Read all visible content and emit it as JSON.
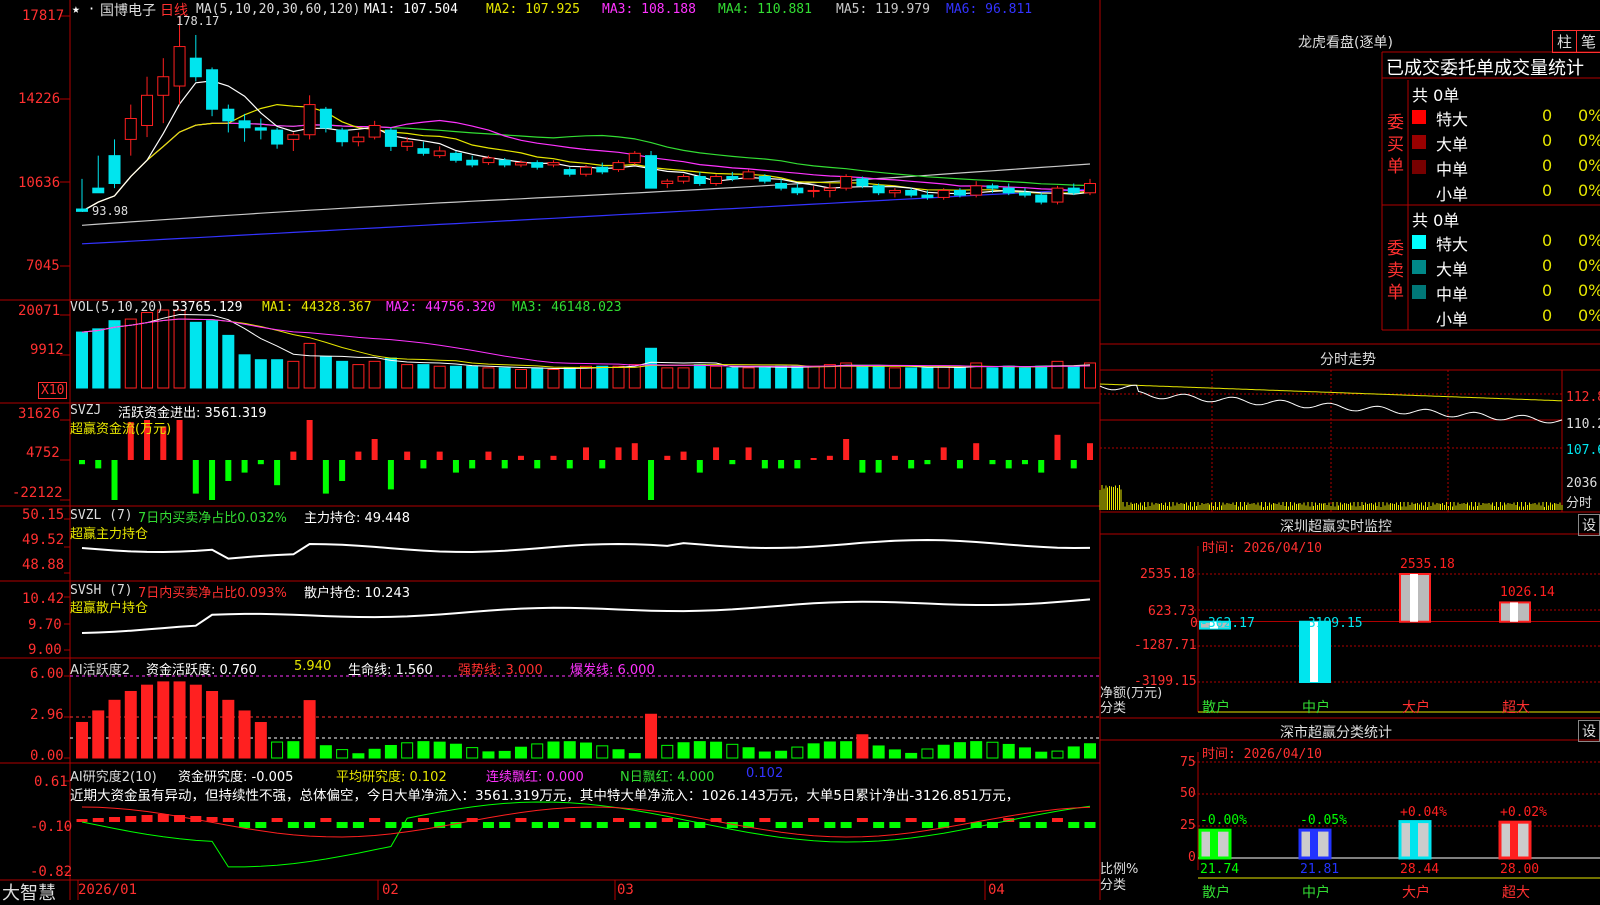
{
  "colors": {
    "bg": "#000000",
    "grid": "#b00000",
    "up": "#ff2020",
    "down": "#00e5ee",
    "ma1": "#ffffff",
    "ma2": "#e6e600",
    "ma3": "#ff33ff",
    "ma4": "#33dd33",
    "ma5": "#c8c8c8",
    "ma6": "#3333ff",
    "neg_green": "#00ff00"
  },
  "header": {
    "stock_name": "国博电子",
    "period": "日线",
    "ma_params": "MA(5,10,20,30,60,120)",
    "ma1": "MA1: 107.504",
    "ma2": "MA2: 107.925",
    "ma3": "MA3: 108.188",
    "ma4": "MA4: 110.881",
    "ma5": "MA5: 119.979",
    "ma6": "MA6: 96.811",
    "high_marker": "178.17",
    "low_marker": "93.98"
  },
  "price_axis": [
    "17817",
    "14226",
    "10636",
    "7045"
  ],
  "vol_panel": {
    "title": "VOL(5,10,20)",
    "value": "53765.129",
    "ma1": "MA1: 44328.367",
    "ma2": "MA2: 44756.320",
    "ma3": "MA3: 46148.023",
    "axis": [
      "20071",
      "9912"
    ],
    "unit": "X10"
  },
  "svzj_panel": {
    "title": "SVZJ",
    "label": "活跃资金进出: 3561.319",
    "sub": "超赢资金流(万元)",
    "axis": [
      "31626",
      "4752",
      "-22122"
    ]
  },
  "svzl_panel": {
    "title": "SVZL (7)",
    "label": "7日内买卖净占比0.032%",
    "label2": "主力持仓: 49.448",
    "sub": "超赢主力持仓",
    "axis": [
      "50.15",
      "49.52",
      "48.88"
    ]
  },
  "svsh_panel": {
    "title": "SVSH (7)",
    "label": "7日内买卖净占比0.093%",
    "label2": "散户持仓: 10.243",
    "sub": "超赢散户持仓",
    "axis": [
      "10.42",
      "9.70",
      "9.00"
    ]
  },
  "ai_active_panel": {
    "title": "AI活跃度2",
    "label": "资金活跃度: 0.760",
    "v2": "5.940",
    "label3": "生命线: 1.560",
    "label4": "强势线: 3.000",
    "label5": "爆发线: 6.000",
    "axis": [
      "6.00",
      "2.96",
      "0.00"
    ]
  },
  "ai_research_panel": {
    "title": "AI研究度2(10)",
    "label": "资金研究度: -0.005",
    "label2": "平均研究度: 0.102",
    "label3": "连续飘红: 0.000",
    "label4": "N日飘红: 4.000",
    "label5": "0.102",
    "comment": "近期大资金虽有异动，但持续性不强，总体偏空，今日大单净流入：3561.319万元，其中特大单净流入：1026.143万元，大单5日累计净出-3126.851万元，",
    "axis": [
      "0.61",
      "-0.10",
      "-0.82"
    ]
  },
  "date_axis": [
    "2026/01",
    "02",
    "03",
    "04"
  ],
  "brand": "大智慧",
  "right": {
    "dragon_title": "龙虎看盘(逐单)",
    "tab_bar": "柱",
    "tab_line": "笔",
    "stats_title": "已成交委托单成交量统计",
    "buy_total": "共 0单",
    "buy_side": "委买单",
    "sell_total": "共 0单",
    "sell_side": "委卖单",
    "rows": [
      {
        "name": "特大",
        "count": "0",
        "pct": "0%"
      },
      {
        "name": "大单",
        "count": "0",
        "pct": "0%"
      },
      {
        "name": "中单",
        "count": "0",
        "pct": "0%"
      },
      {
        "name": "小单",
        "count": "0",
        "pct": "0%"
      }
    ],
    "buy_colors": [
      "#ff0000",
      "#990000",
      "#770000",
      "#000000"
    ],
    "sell_colors": [
      "#00ffff",
      "#008888",
      "#007777",
      "#000000"
    ],
    "intraday_title": "分时走势",
    "intraday_axis": [
      "112.8",
      "110.2",
      "107.6"
    ],
    "intraday_vol": "2036",
    "intraday_vol_unit": "分时",
    "monitor_title": "深圳超赢实时监控",
    "setting": "设",
    "monitor_time": "时间: 2026/04/10",
    "monitor_axis": [
      "2535.18",
      "623.73",
      "0",
      "-1287.71",
      "-3199.15"
    ],
    "monitor_unit": "净额(万元)",
    "monitor_cat": "分类",
    "classify_title": "深市超赢分类统计",
    "classify_time": "时间: 2026/04/10",
    "classify_axis": [
      "75",
      "50",
      "25",
      "0"
    ],
    "classify_unit": "比例%",
    "classify_cat": "分类",
    "categories": [
      "散户",
      "中户",
      "大户",
      "超大"
    ]
  },
  "chart_data": [
    {
      "type": "bar",
      "title": "深圳超赢实时监控",
      "ylabel": "净额(万元)",
      "categories": [
        "散户",
        "中户",
        "大户",
        "超大"
      ],
      "values": [
        -362.17,
        -3199.15,
        2535.18,
        1026.14
      ],
      "value_labels": [
        "-362.17",
        "-3199.15",
        "2535.18",
        "1026.14"
      ],
      "ylim": [
        -3199.15,
        2535.18
      ]
    },
    {
      "type": "bar",
      "title": "深市超赢分类统计",
      "ylabel": "比例%",
      "categories": [
        "散户",
        "中户",
        "大户",
        "超大"
      ],
      "values": [
        21.74,
        21.81,
        28.44,
        28.0
      ],
      "value_labels": [
        "21.74",
        "21.81",
        "28.44",
        "28.00"
      ],
      "change_labels": [
        "-0.00%",
        "-0.05%",
        "+0.04%",
        "+0.02%"
      ],
      "ylim": [
        0,
        75
      ]
    },
    {
      "type": "line",
      "title": "candlestick",
      "ylim": [
        70.45,
        178.17
      ],
      "candles": [
        [
          95,
          108,
          93.98,
          94
        ],
        [
          104,
          118,
          102,
          102
        ],
        [
          118,
          125,
          104,
          106
        ],
        [
          125,
          140,
          118,
          134
        ],
        [
          131,
          152,
          126,
          144
        ],
        [
          144,
          160,
          132,
          152
        ],
        [
          148,
          178.17,
          140,
          165
        ],
        [
          160,
          170,
          150,
          152
        ],
        [
          155,
          156,
          135,
          138
        ],
        [
          138,
          140,
          128,
          133
        ],
        [
          133,
          136,
          124,
          130
        ],
        [
          130,
          134,
          125,
          129
        ],
        [
          129,
          130,
          121,
          123
        ],
        [
          125,
          128,
          120,
          127
        ],
        [
          127,
          144,
          125,
          140
        ],
        [
          138,
          139,
          128,
          130
        ],
        [
          129,
          130,
          122,
          124
        ],
        [
          124,
          128,
          122,
          126
        ],
        [
          126,
          133,
          125,
          131
        ],
        [
          129,
          130,
          120,
          122
        ],
        [
          122,
          126,
          120,
          124
        ],
        [
          121,
          124,
          118,
          119
        ],
        [
          118,
          122,
          117,
          120
        ],
        [
          119,
          120,
          115,
          116
        ],
        [
          116,
          118,
          113,
          114
        ],
        [
          115,
          118,
          114,
          117
        ],
        [
          116,
          117,
          113,
          114
        ],
        [
          114,
          116,
          113,
          115
        ],
        [
          115,
          116,
          112,
          113
        ],
        [
          114,
          116,
          113,
          115
        ],
        [
          112,
          113,
          109,
          110
        ],
        [
          110,
          114,
          109,
          113
        ],
        [
          113,
          115,
          110,
          111
        ],
        [
          112,
          116,
          111,
          115
        ],
        [
          115,
          120,
          114,
          119
        ],
        [
          118,
          120,
          104,
          104
        ],
        [
          106,
          108,
          104,
          107
        ],
        [
          107,
          110,
          106,
          109
        ],
        [
          109,
          111,
          105,
          106
        ],
        [
          106,
          110,
          105,
          109
        ],
        [
          109,
          111,
          107,
          108
        ],
        [
          108,
          112,
          108,
          111
        ],
        [
          109,
          110,
          106,
          107
        ],
        [
          106,
          108,
          103,
          104
        ],
        [
          104,
          106,
          101,
          102
        ],
        [
          103,
          105,
          100,
          103
        ],
        [
          103,
          106,
          100,
          104
        ],
        [
          104,
          110,
          103,
          109
        ],
        [
          108,
          109,
          104,
          105
        ],
        [
          105,
          106,
          101,
          102
        ],
        [
          102,
          104,
          100,
          103
        ],
        [
          103,
          104,
          100,
          101
        ],
        [
          101,
          103,
          99,
          100
        ],
        [
          100,
          104,
          99,
          103
        ],
        [
          103,
          104,
          100,
          101
        ],
        [
          101,
          107,
          100,
          105
        ],
        [
          105,
          106,
          102,
          104
        ],
        [
          104,
          106,
          101,
          102
        ],
        [
          102,
          104,
          100,
          101
        ],
        [
          101,
          102,
          97,
          98
        ],
        [
          98,
          105,
          97,
          104
        ],
        [
          104,
          106,
          101,
          102
        ],
        [
          102,
          108,
          101,
          106
        ]
      ]
    }
  ]
}
